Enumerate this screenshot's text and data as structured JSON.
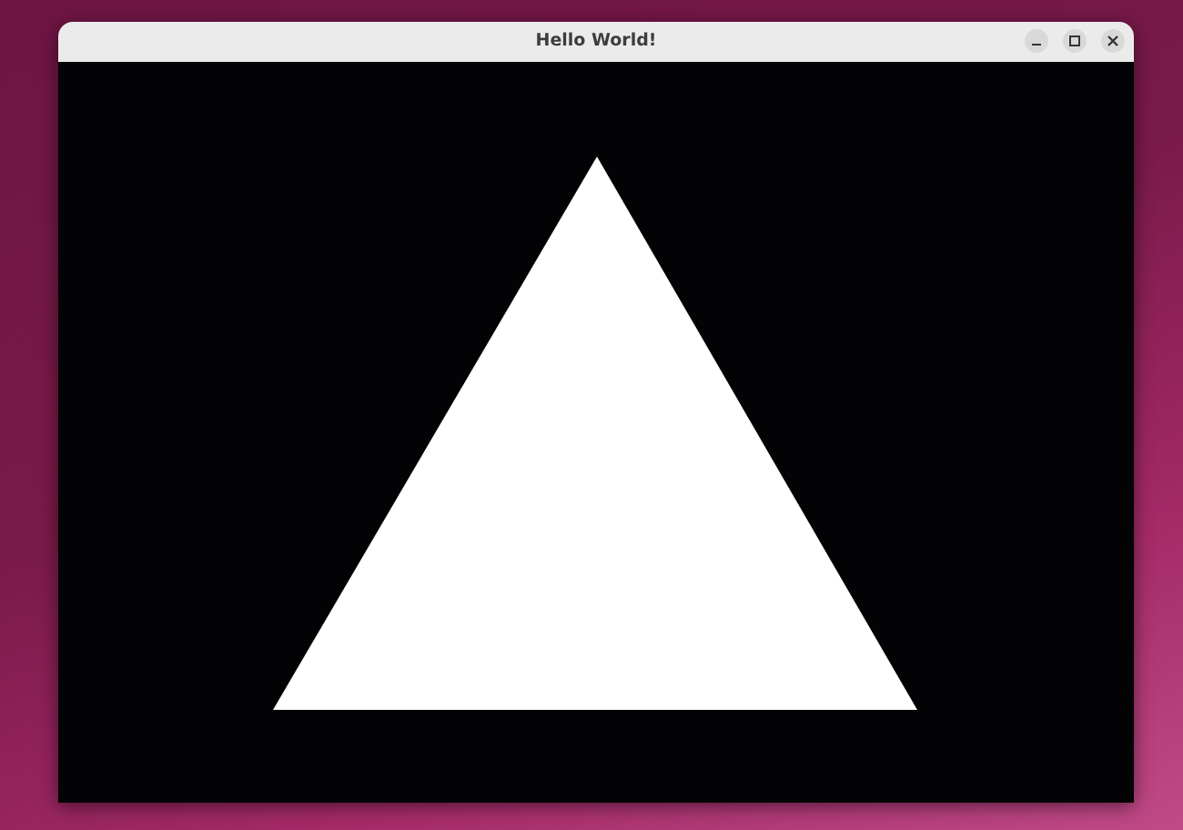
{
  "window": {
    "title": "Hello World!"
  }
}
